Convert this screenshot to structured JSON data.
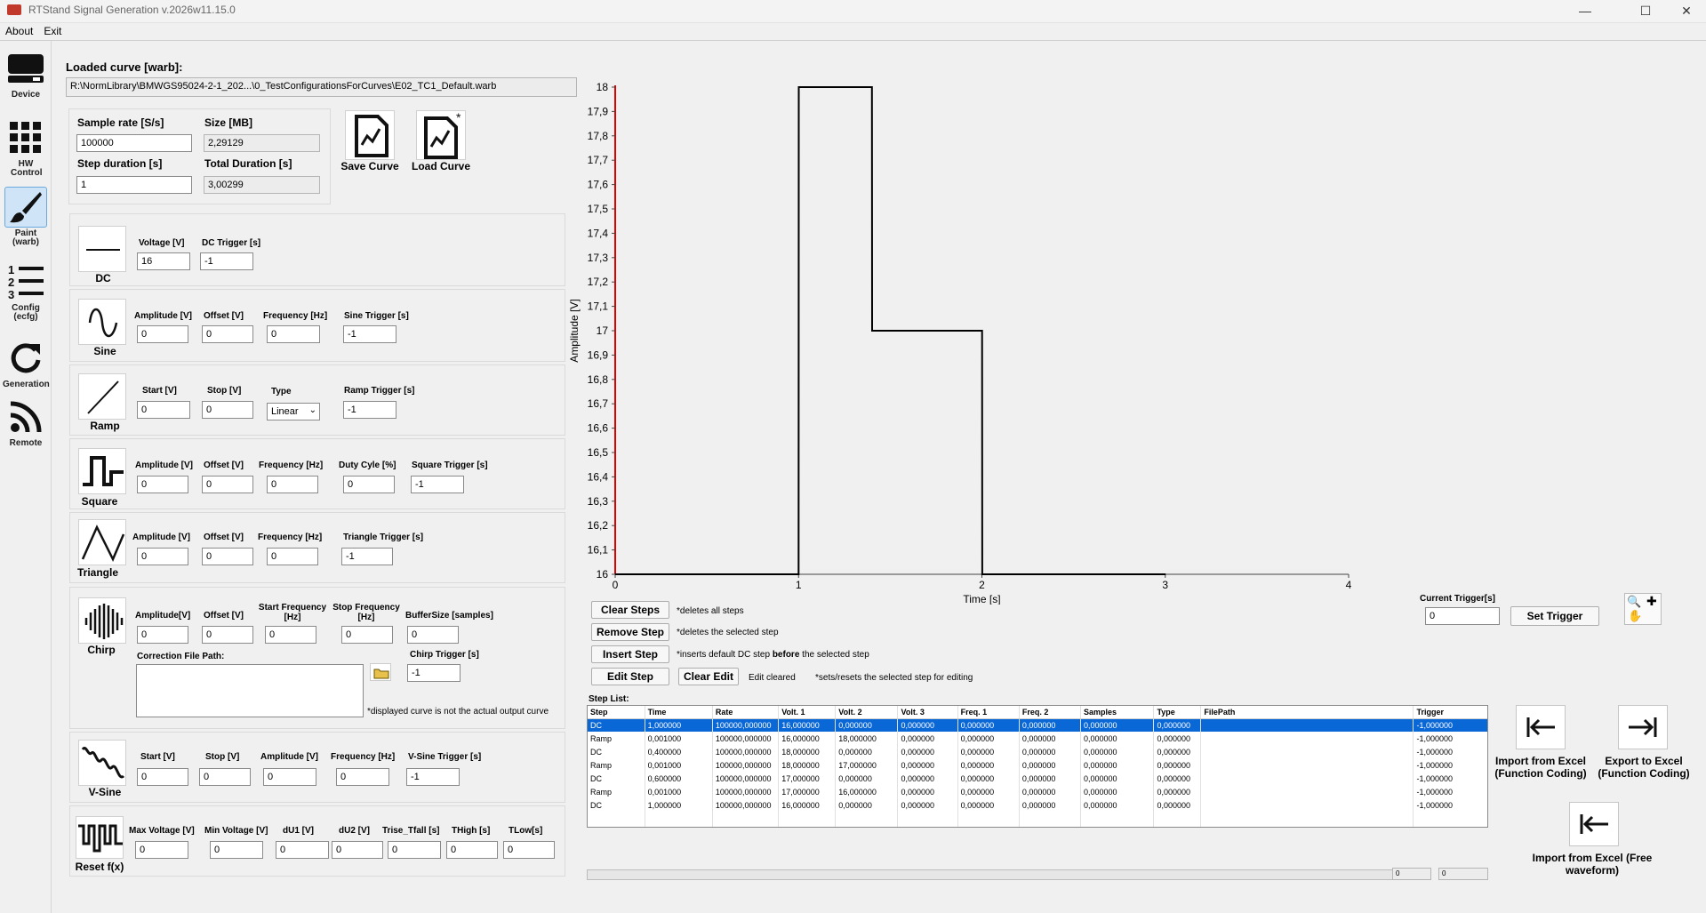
{
  "window": {
    "title": "RTStand Signal Generation v.2026w11.15.0"
  },
  "menu": [
    "About",
    "Exit"
  ],
  "sidebar": [
    {
      "label": "Device",
      "icon": "drive-icon"
    },
    {
      "label": "HW Control",
      "icon": "grid-icon"
    },
    {
      "label": "Paint (warb)",
      "icon": "brush-icon"
    },
    {
      "label": "Config (ecfg)",
      "icon": "numbered-list-icon"
    },
    {
      "label": "Generation",
      "icon": "refresh-icon"
    },
    {
      "label": "Remote",
      "icon": "rss-icon"
    }
  ],
  "loaded": {
    "label": "Loaded curve [warb]:",
    "path": "R:\\NormLibrary\\BMWGS95024-2-1_202...\\0_TestConfigurationsForCurves\\E02_TC1_Default.warb"
  },
  "params": {
    "sample_rate_label": "Sample rate [S/s]",
    "sample_rate": "100000",
    "size_label": "Size [MB]",
    "size": "2,29129",
    "step_duration_label": "Step duration [s]",
    "step_duration": "1",
    "total_duration_label": "Total Duration [s]",
    "total_duration": "3,00299"
  },
  "curve_buttons": {
    "save": "Save Curve",
    "load": "Load Curve"
  },
  "dc": {
    "name": "DC",
    "voltage_label": "Voltage [V]",
    "voltage": "16",
    "trigger_label": "DC Trigger [s]",
    "trigger": "-1"
  },
  "sine": {
    "name": "Sine",
    "amp_label": "Amplitude [V]",
    "amp": "0",
    "offset_label": "Offset [V]",
    "offset": "0",
    "freq_label": "Frequency [Hz]",
    "freq": "0",
    "trigger_label": "Sine Trigger [s]",
    "trigger": "-1"
  },
  "ramp": {
    "name": "Ramp",
    "start_label": "Start [V]",
    "start": "0",
    "stop_label": "Stop [V]",
    "stop": "0",
    "type_label": "Type",
    "type": "Linear",
    "trigger_label": "Ramp Trigger [s]",
    "trigger": "-1"
  },
  "square": {
    "name": "Square",
    "amp_label": "Amplitude [V]",
    "amp": "0",
    "offset_label": "Offset [V]",
    "offset": "0",
    "freq_label": "Frequency [Hz]",
    "freq": "0",
    "duty_label": "Duty Cyle [%]",
    "duty": "0",
    "trigger_label": "Square Trigger [s]",
    "trigger": "-1"
  },
  "triangle": {
    "name": "Triangle",
    "amp_label": "Amplitude [V]",
    "amp": "0",
    "offset_label": "Offset [V]",
    "offset": "0",
    "freq_label": "Frequency [Hz]",
    "freq": "0",
    "trigger_label": "Triangle Trigger [s]",
    "trigger": "-1"
  },
  "chirp": {
    "name": "Chirp",
    "amp_label": "Amplitude[V]",
    "amp": "0",
    "offset_label": "Offset [V]",
    "offset": "0",
    "start_label": "Start Frequency [Hz]",
    "start": "0",
    "stop_label": "Stop Frequency [Hz]",
    "stop": "0",
    "buffer_label": "BufferSize [samples]",
    "buffer": "0",
    "corr_label": "Correction File Path:",
    "trigger_label": "Chirp Trigger [s]",
    "trigger": "-1",
    "note": "*displayed curve is not the actual output curve"
  },
  "vsine": {
    "name": "V-Sine",
    "start_label": "Start [V]",
    "start": "0",
    "stop_label": "Stop [V]",
    "stop": "0",
    "amp_label": "Amplitude [V]",
    "amp": "0",
    "freq_label": "Frequency [Hz]",
    "freq": "0",
    "trigger_label": "V-Sine Trigger [s]",
    "trigger": "-1"
  },
  "reset": {
    "name": "Reset f(x)",
    "maxv_label": "Max Voltage [V]",
    "maxv": "0",
    "minv_label": "Min Voltage [V]",
    "minv": "0",
    "du1_label": "dU1 [V]",
    "du1": "0",
    "du2_label": "dU2 [V]",
    "du2": "0",
    "trise_label": "Trise_Tfall [s]",
    "trise": "0",
    "thigh_label": "THigh [s]",
    "thigh": "0",
    "tlow_label": "TLow[s]",
    "tlow": "0"
  },
  "steps": {
    "clear": "Clear Steps",
    "clear_note": "*deletes all steps",
    "remove": "Remove Step",
    "remove_note": "*deletes the selected step",
    "insert": "Insert Step",
    "insert_note_a": "*inserts default DC step ",
    "insert_note_b": "before",
    "insert_note_c": " the selected step",
    "edit": "Edit Step",
    "clear_edit": "Clear Edit",
    "edit_status": "Edit cleared",
    "edit_note": "*sets/resets the selected step for editing",
    "list_label": "Step List:"
  },
  "trigger": {
    "label": "Current Trigger[s]",
    "value": "0",
    "button": "Set Trigger"
  },
  "table": {
    "headers": [
      "Step",
      "Time",
      "Rate",
      "Volt. 1",
      "Volt. 2",
      "Volt. 3",
      "Freq. 1",
      "Freq. 2",
      "Samples",
      "Type",
      "FilePath",
      "Trigger"
    ],
    "rows": [
      [
        "DC",
        "1,000000",
        "100000,000000",
        "16,000000",
        "0,000000",
        "0,000000",
        "0,000000",
        "0,000000",
        "0,000000",
        "0,000000",
        "",
        "-1,000000"
      ],
      [
        "Ramp",
        "0,001000",
        "100000,000000",
        "16,000000",
        "18,000000",
        "0,000000",
        "0,000000",
        "0,000000",
        "0,000000",
        "0,000000",
        "",
        "-1,000000"
      ],
      [
        "DC",
        "0,400000",
        "100000,000000",
        "18,000000",
        "0,000000",
        "0,000000",
        "0,000000",
        "0,000000",
        "0,000000",
        "0,000000",
        "",
        "-1,000000"
      ],
      [
        "Ramp",
        "0,001000",
        "100000,000000",
        "18,000000",
        "17,000000",
        "0,000000",
        "0,000000",
        "0,000000",
        "0,000000",
        "0,000000",
        "",
        "-1,000000"
      ],
      [
        "DC",
        "0,600000",
        "100000,000000",
        "17,000000",
        "0,000000",
        "0,000000",
        "0,000000",
        "0,000000",
        "0,000000",
        "0,000000",
        "",
        "-1,000000"
      ],
      [
        "Ramp",
        "0,001000",
        "100000,000000",
        "17,000000",
        "16,000000",
        "0,000000",
        "0,000000",
        "0,000000",
        "0,000000",
        "0,000000",
        "",
        "-1,000000"
      ],
      [
        "DC",
        "1,000000",
        "100000,000000",
        "16,000000",
        "0,000000",
        "0,000000",
        "0,000000",
        "0,000000",
        "0,000000",
        "0,000000",
        "",
        "-1,000000"
      ]
    ]
  },
  "excel": {
    "import_fc": "Import from Excel (Function Coding)",
    "export_fc": "Export to Excel (Function Coding)",
    "import_fw": "Import from Excel (Free waveform)"
  },
  "status": {
    "v1": "0",
    "v2": "0"
  },
  "chart_data": {
    "type": "line",
    "xlabel": "Time [s]",
    "ylabel": "Amplitude [V]",
    "xlim": [
      0,
      4
    ],
    "ylim": [
      16,
      18
    ],
    "x_ticks": [
      "0",
      "1",
      "2",
      "3",
      "4"
    ],
    "y_ticks": [
      "16",
      "16,1",
      "16,2",
      "16,3",
      "16,4",
      "16,5",
      "16,6",
      "16,7",
      "16,8",
      "16,9",
      "17",
      "17,1",
      "17,2",
      "17,3",
      "17,4",
      "17,5",
      "17,6",
      "17,7",
      "17,8",
      "17,9",
      "18"
    ],
    "series": [
      {
        "color": "#000000",
        "x": [
          0,
          1,
          1.001,
          1.4,
          1.401,
          2.001,
          2.002,
          3.002
        ],
        "y": [
          16,
          16,
          18,
          18,
          17,
          17,
          16,
          16
        ]
      }
    ]
  }
}
